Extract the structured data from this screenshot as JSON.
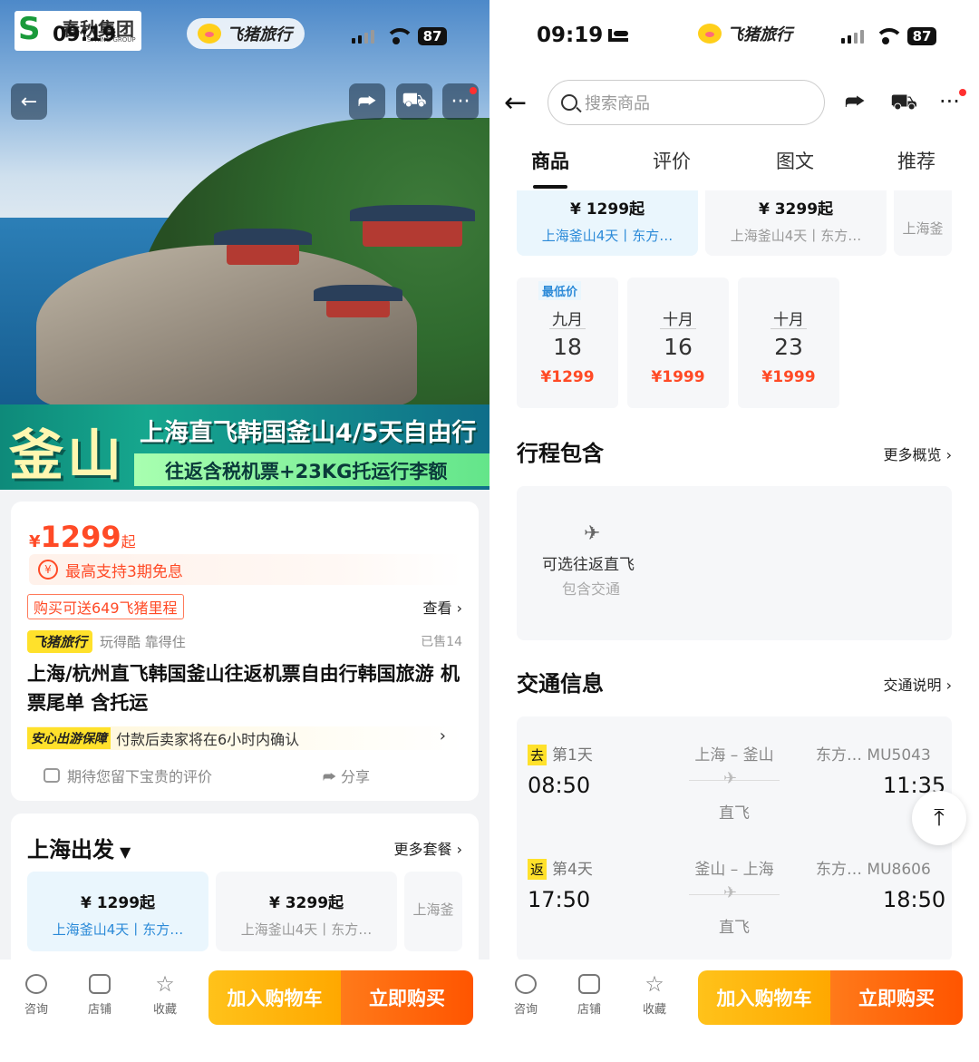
{
  "left": {
    "logo_cn": "春秋集团",
    "logo_en": "SPRING GROUP",
    "status_time": "09:19",
    "brand_pill": "飞猪旅行",
    "battery": "87",
    "banner_big": "釜山",
    "banner_line1": "上海直飞韩国釜山4/5天自由行",
    "banner_line2": "往返含税机票+23KG托运行李额",
    "price_currency": "¥",
    "price_value": "1299",
    "price_suffix": "起",
    "installment": "最高支持3期免息",
    "miles": "购买可送649飞猪里程",
    "view": "查看 ›",
    "brand_tag": "飞猪旅行",
    "brand_slogan": "玩得酷 靠得住",
    "sold": "已售14",
    "product_title": "上海/杭州直飞韩国釜山往返机票自由行韩国旅游 机票尾单 含托运",
    "assure_tag": "安心出游保障",
    "assure_text": "付款后卖家将在6小时内确认",
    "review_hint": "期待您留下宝贵的评价",
    "share": "分享",
    "depart_title": "上海出发",
    "more_packages": "更多套餐 ›",
    "packages": [
      {
        "price": "¥ 1299起",
        "desc": "上海釜山4天丨东方…"
      },
      {
        "price": "¥ 3299起",
        "desc": "上海釜山4天丨东方…"
      },
      {
        "price": "",
        "desc": "上海釜"
      }
    ]
  },
  "right": {
    "status_time": "09:19",
    "brand_pill": "飞猪旅行",
    "battery": "87",
    "search_placeholder": "搜索商品",
    "tabs": [
      "商品",
      "评价",
      "图文",
      "推荐"
    ],
    "packages": [
      {
        "price": "¥ 1299起",
        "desc": "上海釜山4天丨东方…"
      },
      {
        "price": "¥ 3299起",
        "desc": "上海釜山4天丨东方…"
      },
      {
        "price": "",
        "desc": "上海釜"
      }
    ],
    "lowest_label": "最低价",
    "dates": [
      {
        "month": "九月",
        "day": "18",
        "price": "¥1299"
      },
      {
        "month": "十月",
        "day": "16",
        "price": "¥1999"
      },
      {
        "month": "十月",
        "day": "23",
        "price": "¥1999"
      }
    ],
    "itinerary_title": "行程包含",
    "itinerary_more": "更多概览 ›",
    "itinerary_item": "可选往返直飞",
    "itinerary_sub": "包含交通",
    "transport_title": "交通信息",
    "transport_more": "交通说明 ›",
    "flights": [
      {
        "tag": "去",
        "day": "第1天",
        "depart": "08:50",
        "route": "上海 – 釜山",
        "type": "直飞",
        "airline": "东方…",
        "no": "MU5043",
        "arrive": "11:35"
      },
      {
        "tag": "返",
        "day": "第4天",
        "depart": "17:50",
        "route": "釜山 – 上海",
        "type": "直飞",
        "airline": "东方…",
        "no": "MU8606",
        "arrive": "18:50"
      }
    ]
  },
  "bottom": {
    "consult": "咨询",
    "shop": "店铺",
    "favorite": "收藏",
    "add_cart": "加入购物车",
    "buy_now": "立即购买"
  },
  "colors": {
    "accent": "#ff4a26",
    "cart": "#ffa800",
    "buy": "#ff5500",
    "brand_yellow": "#ffe12b",
    "link_blue": "#2b8ad8"
  }
}
